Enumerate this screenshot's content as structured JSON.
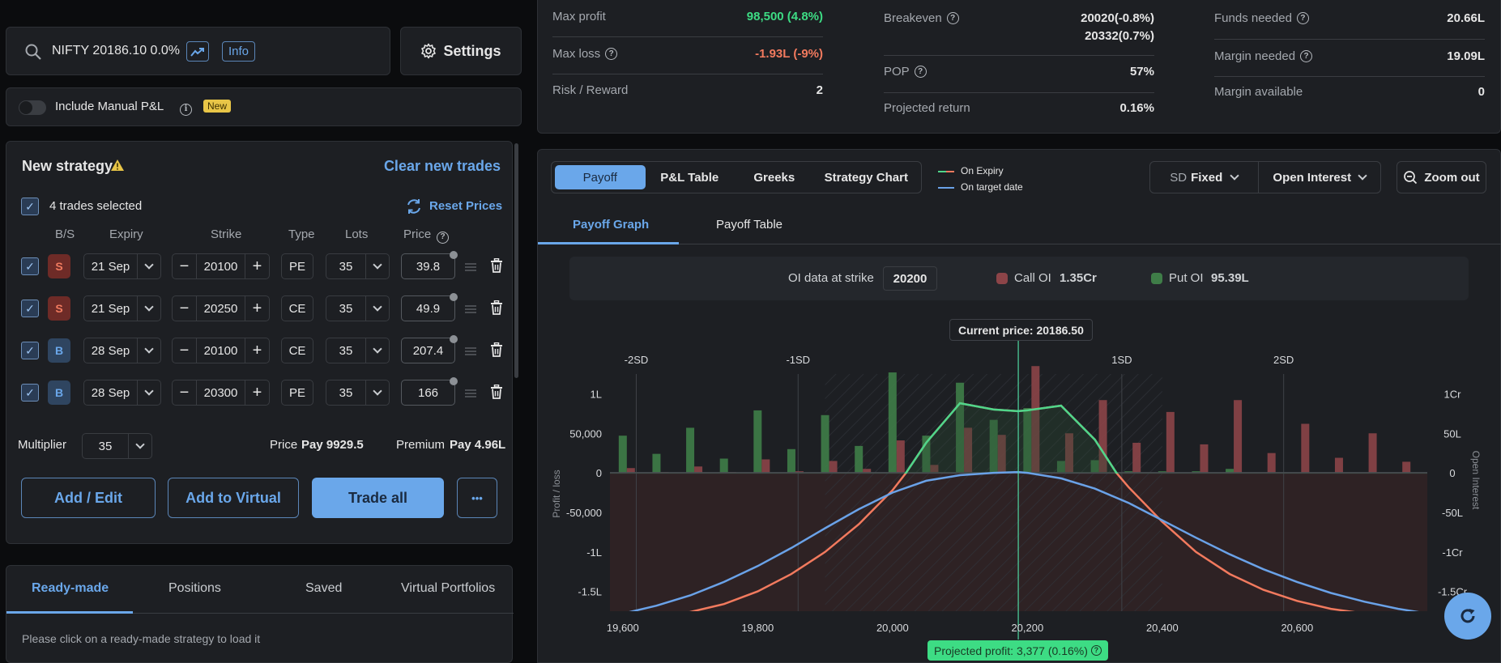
{
  "search": {
    "symbol_text": "NIFTY 20186.10 0.0%",
    "chart_icon": "trending-chart-icon",
    "info_label": "Info"
  },
  "settings_label": "Settings",
  "manual_pnl": {
    "label": "Include Manual P&L",
    "badge": "New",
    "enabled": false
  },
  "strategy": {
    "title": "New strategy",
    "clear_label": "Clear new trades",
    "selected_label": "4 trades selected",
    "reset_label": "Reset Prices",
    "columns": [
      "B/S",
      "Expiry",
      "Strike",
      "Type",
      "Lots",
      "Price"
    ],
    "trades": [
      {
        "side": "S",
        "expiry": "21 Sep",
        "strike": "20100",
        "type": "PE",
        "lots": "35",
        "price": "39.8",
        "checked": true
      },
      {
        "side": "S",
        "expiry": "21 Sep",
        "strike": "20250",
        "type": "CE",
        "lots": "35",
        "price": "49.9",
        "checked": true
      },
      {
        "side": "B",
        "expiry": "28 Sep",
        "strike": "20100",
        "type": "CE",
        "lots": "35",
        "price": "207.4",
        "checked": true
      },
      {
        "side": "B",
        "expiry": "28 Sep",
        "strike": "20300",
        "type": "PE",
        "lots": "35",
        "price": "166",
        "checked": true
      }
    ],
    "multiplier_label": "Multiplier",
    "multiplier_value": "35",
    "price_label": "Price",
    "price_value": "Pay 9929.5",
    "premium_label": "Premium",
    "premium_value": "Pay 4.96L",
    "buttons": {
      "add_edit": "Add / Edit",
      "add_virtual": "Add to Virtual",
      "trade_all": "Trade all",
      "more": "•••"
    }
  },
  "bottom_tabs": {
    "tabs": [
      "Ready-made",
      "Positions",
      "Saved",
      "Virtual Portfolios"
    ],
    "active": "Ready-made",
    "message": "Please click on a ready-made strategy to load it"
  },
  "stats": {
    "max_profit": {
      "label": "Max profit",
      "value": "98,500 (4.8%)"
    },
    "max_loss": {
      "label": "Max loss",
      "value": "-1.93L (-9%)"
    },
    "risk_reward": {
      "label": "Risk / Reward",
      "value": "2"
    },
    "breakeven": {
      "label": "Breakeven",
      "value1": "20020(-0.8%)",
      "value2": "20332(0.7%)"
    },
    "pop": {
      "label": "POP",
      "value": "57%"
    },
    "projected_return": {
      "label": "Projected return",
      "value": "0.16%"
    },
    "funds_needed": {
      "label": "Funds needed",
      "value": "20.66L"
    },
    "margin_needed": {
      "label": "Margin needed",
      "value": "19.09L"
    },
    "margin_available": {
      "label": "Margin available",
      "value": "0"
    }
  },
  "chart_tabs": {
    "tabs": [
      "Payoff",
      "P&L Table",
      "Greeks",
      "Strategy Chart"
    ],
    "active": "Payoff",
    "legend": [
      "On Expiry",
      "On target date"
    ],
    "sd_label": "SD",
    "sd_value": "Fixed",
    "oi_label": "Open Interest",
    "zoom_label": "Zoom out",
    "subtabs": [
      "Payoff Graph",
      "Payoff Table"
    ],
    "active_subtab": "Payoff Graph"
  },
  "oi_info": {
    "label": "OI data at strike",
    "strike": "20200",
    "call_label": "Call OI",
    "call_value": "1.35Cr",
    "put_label": "Put OI",
    "put_value": "95.39L"
  },
  "colors": {
    "accent": "#6aa7ea",
    "profit": "#3ddc84",
    "loss": "#f27a5e",
    "call_oi": "#8c4448",
    "put_oi": "#3f7d48",
    "expiry_line": "#4fd68a",
    "target_line": "#6aa2e8"
  },
  "chart_data": {
    "type": "line",
    "title": "Payoff Graph",
    "xlabel": "",
    "ylabel": "Profit / loss",
    "y2label": "Open Interest",
    "xlim": [
      19581,
      20793
    ],
    "ylim": [
      -175000,
      125000
    ],
    "y2lim": [
      -1750000000,
      1250000000
    ],
    "x_ticks": [
      "19,600",
      "19,800",
      "20,000",
      "20,200",
      "20,400",
      "20,600"
    ],
    "x_tick_values": [
      19600,
      19800,
      20000,
      20200,
      20400,
      20600
    ],
    "y_ticks": [
      "1L",
      "50,000",
      "0",
      "-50,000",
      "-1L",
      "-1.5L"
    ],
    "y_tick_values": [
      100000,
      50000,
      0,
      -50000,
      -100000,
      -150000
    ],
    "y2_ticks": [
      "1Cr",
      "50L",
      "0",
      "-50L",
      "-1Cr",
      "-1.5Cr"
    ],
    "y2_tick_values": [
      10000000,
      5000000,
      0,
      -5000000,
      -10000000,
      -15000000
    ],
    "sd_markers": [
      {
        "label": "-2SD",
        "x": 19620
      },
      {
        "label": "-1SD",
        "x": 19860
      },
      {
        "label": "1SD",
        "x": 20340
      },
      {
        "label": "2SD",
        "x": 20580
      }
    ],
    "current_price": {
      "label": "Current price: 20186.50",
      "x": 20186.5
    },
    "projected_profit": "Projected profit: 3,377 (0.16%)",
    "series": [
      {
        "name": "On Expiry",
        "x": [
          19581,
          19650,
          19700,
          19750,
          19800,
          19850,
          19900,
          19950,
          20000,
          20020,
          20050,
          20100,
          20150,
          20186,
          20200,
          20250,
          20300,
          20332,
          20350,
          20400,
          20450,
          20500,
          20550,
          20600,
          20650,
          20700,
          20750,
          20793
        ],
        "y": [
          -186000,
          -182000,
          -176000,
          -166000,
          -150000,
          -128000,
          -100000,
          -65000,
          -22000,
          0,
          38000,
          88000,
          80000,
          78000,
          79000,
          85000,
          42000,
          0,
          -18000,
          -62000,
          -100000,
          -128000,
          -148000,
          -162000,
          -172000,
          -178000,
          -182000,
          -184000
        ]
      },
      {
        "name": "On target date",
        "x": [
          19581,
          19650,
          19700,
          19750,
          19800,
          19850,
          19900,
          19950,
          20000,
          20050,
          20100,
          20150,
          20186,
          20200,
          20250,
          20300,
          20350,
          20400,
          20450,
          20500,
          20550,
          20600,
          20650,
          20700,
          20750,
          20793
        ],
        "y": [
          -182000,
          -168000,
          -155000,
          -138000,
          -118000,
          -95000,
          -70000,
          -46000,
          -25000,
          -10000,
          -3000,
          0,
          1000,
          0,
          -7000,
          -20000,
          -38000,
          -60000,
          -82000,
          -103000,
          -122000,
          -138000,
          -152000,
          -163000,
          -172000,
          -178000
        ]
      }
    ],
    "oi_strikes": [
      19600,
      19650,
      19700,
      19750,
      19800,
      19850,
      19900,
      19950,
      20000,
      20050,
      20100,
      20150,
      20200,
      20250,
      20300,
      20350,
      20400,
      20450,
      20500,
      20550,
      20600,
      20650,
      20700,
      20750
    ],
    "put_oi": [
      4700000,
      2400000,
      5700000,
      1800000,
      7900000,
      3000000,
      7300000,
      3400000,
      12700000,
      4700000,
      11400000,
      6700000,
      8200000,
      1500000,
      1600000,
      200000,
      200000,
      200000,
      500000,
      0,
      0,
      0,
      0,
      0
    ],
    "call_oi": [
      600000,
      100000,
      800000,
      100000,
      1700000,
      200000,
      1500000,
      500000,
      4100000,
      1000000,
      5700000,
      4800000,
      13500000,
      5000000,
      9200000,
      3800000,
      7700000,
      3600000,
      9200000,
      2500000,
      6200000,
      1900000,
      5000000,
      1400000
    ]
  }
}
